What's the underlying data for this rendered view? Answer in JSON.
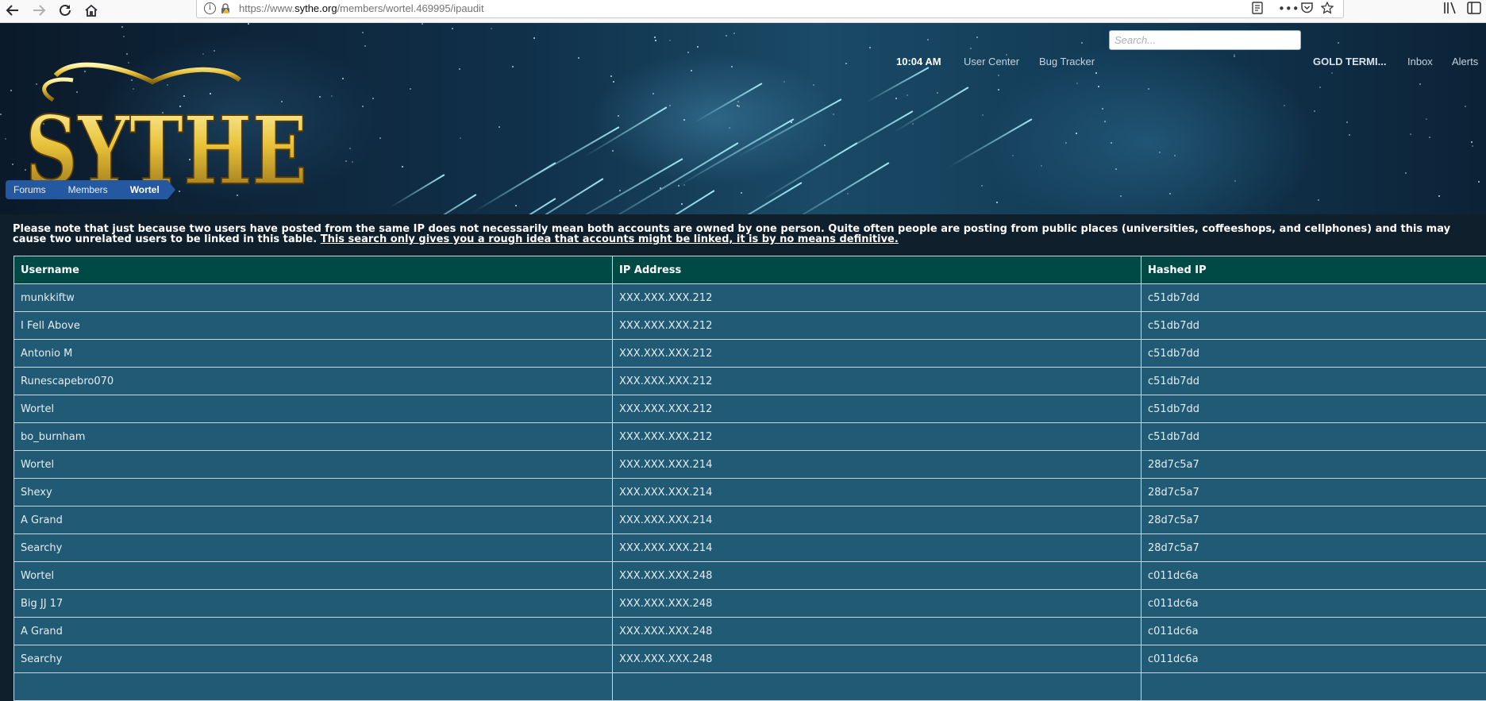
{
  "browser": {
    "url_prefix": "https://www.",
    "url_host": "sythe.org",
    "url_path": "/members/wortel.469995/ipaudit"
  },
  "header": {
    "logo_text": "SYTHE",
    "time": "10:04 AM",
    "nav": {
      "user_center": "User Center",
      "bug_tracker": "Bug Tracker",
      "account": "GOLD TERMI...",
      "inbox": "Inbox",
      "alerts": "Alerts"
    },
    "search_placeholder": "Search..."
  },
  "breadcrumb": [
    "Forums",
    "Members",
    "Wortel"
  ],
  "notice": {
    "text": "Please note that just because two users have posted from the same IP does not necessarily mean both accounts are owned by one person. Quite often people are posting from public places (universities, coffeeshops, and cellphones) and this may cause two unrelated users to be linked in this table.",
    "emphasis": "This search only gives you a rough idea that accounts might be linked, it is by no means definitive."
  },
  "table": {
    "headers": [
      "Username",
      "IP Address",
      "Hashed IP"
    ],
    "rows": [
      [
        "munkkiftw",
        "XXX.XXX.XXX.212",
        "c51db7dd"
      ],
      [
        "I Fell Above",
        "XXX.XXX.XXX.212",
        "c51db7dd"
      ],
      [
        "Antonio M",
        "XXX.XXX.XXX.212",
        "c51db7dd"
      ],
      [
        "Runescapebro070",
        "XXX.XXX.XXX.212",
        "c51db7dd"
      ],
      [
        "Wortel",
        "XXX.XXX.XXX.212",
        "c51db7dd"
      ],
      [
        "bo_burnham",
        "XXX.XXX.XXX.212",
        "c51db7dd"
      ],
      [
        "Wortel",
        "XXX.XXX.XXX.214",
        "28d7c5a7"
      ],
      [
        "Shexy",
        "XXX.XXX.XXX.214",
        "28d7c5a7"
      ],
      [
        "A Grand",
        "XXX.XXX.XXX.214",
        "28d7c5a7"
      ],
      [
        "Searchy",
        "XXX.XXX.XXX.214",
        "28d7c5a7"
      ],
      [
        "Wortel",
        "XXX.XXX.XXX.248",
        "c011dc6a"
      ],
      [
        "Big JJ 17",
        "XXX.XXX.XXX.248",
        "c011dc6a"
      ],
      [
        "A Grand",
        "XXX.XXX.XXX.248",
        "c011dc6a"
      ],
      [
        "Searchy",
        "XXX.XXX.XXX.248",
        "c011dc6a"
      ],
      [
        "",
        "",
        ""
      ]
    ]
  },
  "colors": {
    "header_row": "#004a46",
    "body_row": "#215a74",
    "breadcrumb": "#2458a0",
    "page_bg": "#0f1f2c"
  }
}
